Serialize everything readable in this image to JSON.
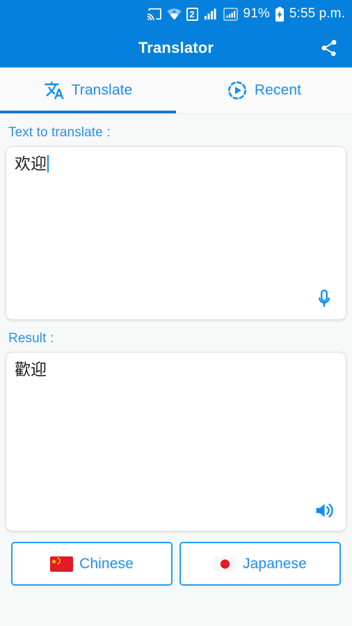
{
  "status_bar": {
    "icons": [
      {
        "name": "cast-icon",
        "label": "cast"
      },
      {
        "name": "wifi-icon",
        "label": "wifi"
      },
      {
        "name": "sim-badge-icon",
        "label": "2"
      },
      {
        "name": "signal-sim1-icon",
        "label": "signal"
      },
      {
        "name": "signal-sim2-icon",
        "label": "signal"
      }
    ],
    "battery_percent": "91%",
    "battery_icon": "battery-charging-icon",
    "clock": "5:55 p.m."
  },
  "app_bar": {
    "title": "Translator",
    "share_icon": "share-icon"
  },
  "tabs": [
    {
      "label": "Translate",
      "icon": "translate-icon",
      "active": true
    },
    {
      "label": "Recent",
      "icon": "history-restore-icon",
      "active": false
    }
  ],
  "input_section": {
    "label": "Text to translate :",
    "value": "欢迎",
    "placeholder": "",
    "action_icon": "microphone-icon"
  },
  "result_section": {
    "label": "Result :",
    "value": "歡迎",
    "action_icon": "speaker-volume-icon"
  },
  "language_buttons": [
    {
      "name": "Chinese",
      "flag_icon": "flag-china-icon"
    },
    {
      "name": "Japanese",
      "flag_icon": "flag-japan-icon"
    }
  ],
  "colors": {
    "primary_blue": "#0580dc",
    "accent_blue": "#1b8cf0",
    "tab_indicator": "#1477d4",
    "button_border": "#1f9dfb",
    "page_background": "#f7f8f8",
    "card_background": "#ffffff"
  }
}
